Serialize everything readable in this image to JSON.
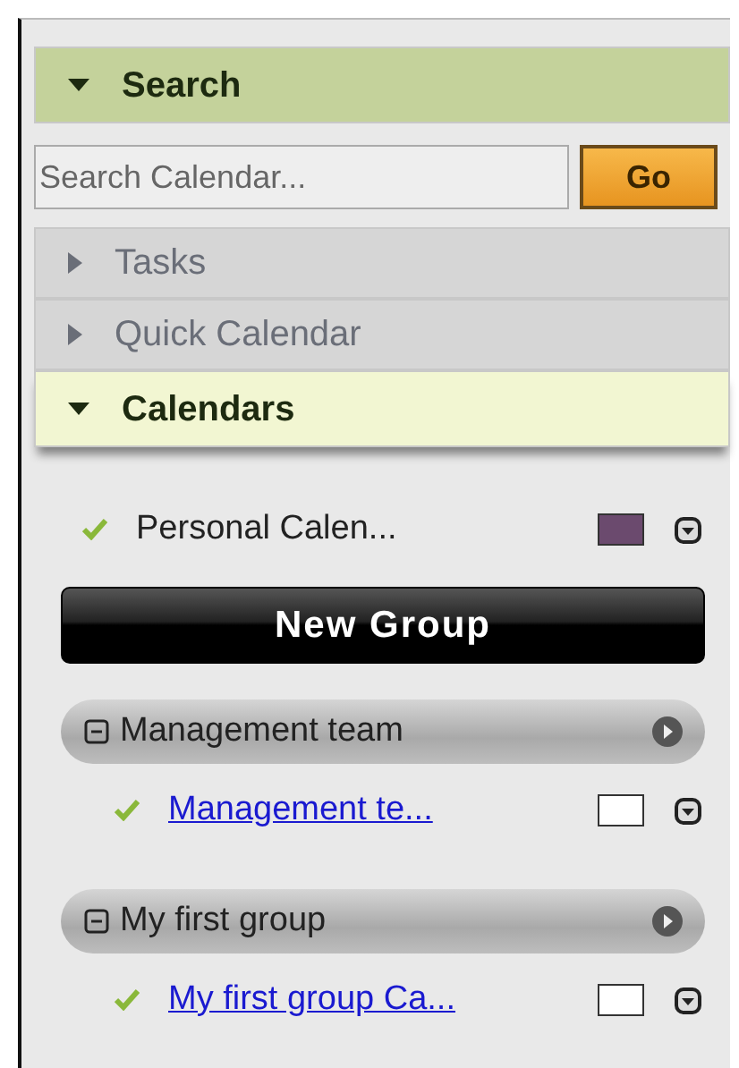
{
  "search": {
    "title": "Search",
    "expanded": true,
    "placeholder": "Search Calendar...",
    "button": "Go"
  },
  "collapsed_sections": [
    {
      "title": "Tasks",
      "expanded": false
    },
    {
      "title": "Quick Calendar",
      "expanded": false
    }
  ],
  "calendars": {
    "title": "Calendars",
    "expanded": true,
    "personal": {
      "name": "Personal Calen...",
      "checked": true,
      "color": "#6b4a6e"
    },
    "new_group_button": "New Group",
    "groups": [
      {
        "name": "Management team",
        "expanded": true,
        "calendars": [
          {
            "name": "Management te...",
            "checked": true,
            "color": "#ffffff"
          }
        ]
      },
      {
        "name": "My first group",
        "expanded": true,
        "calendars": [
          {
            "name": "My first group Ca...",
            "checked": true,
            "color": "#ffffff"
          }
        ]
      }
    ]
  }
}
